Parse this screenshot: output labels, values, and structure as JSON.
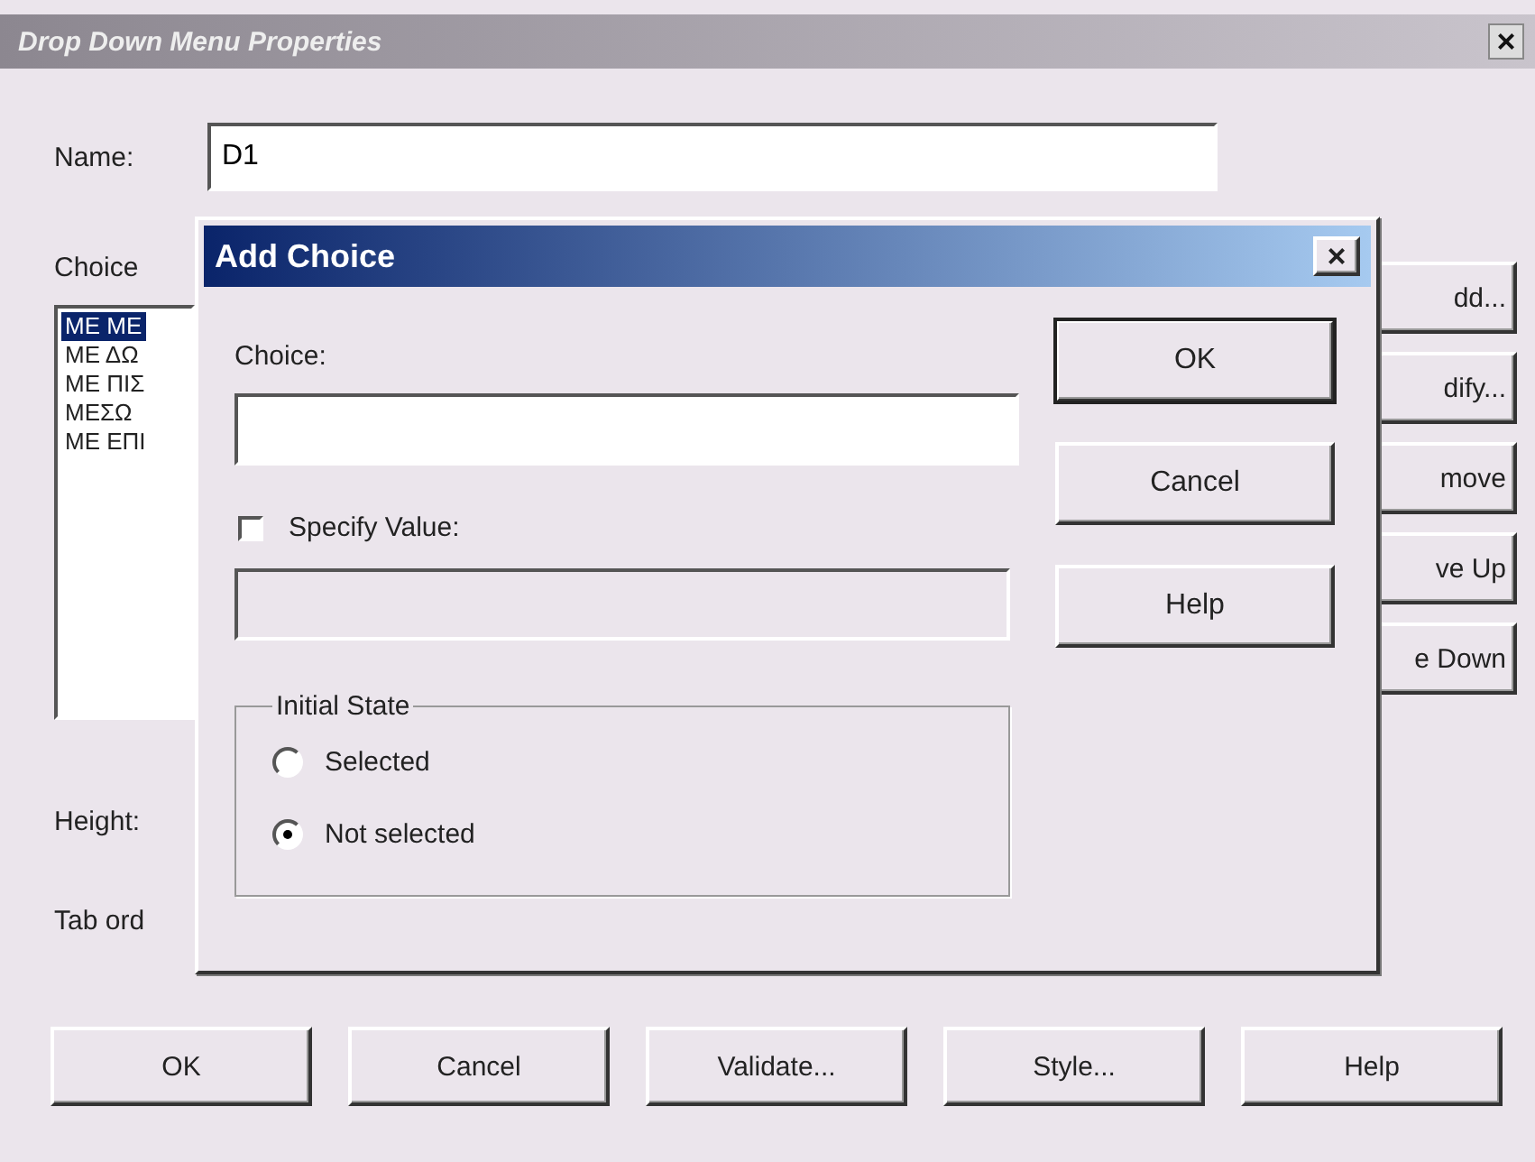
{
  "window": {
    "title": "Drop Down Menu Properties",
    "close": "×"
  },
  "name_field": {
    "label": "Name:",
    "value": "D1"
  },
  "choice_label": "Choice",
  "choices": [
    {
      "text": "ΜΕ ΜΕ",
      "selected": true
    },
    {
      "text": "ΜΕ ΔΩ",
      "selected": false
    },
    {
      "text": "ΜΕ ΠΙΣ",
      "selected": false
    },
    {
      "text": "ΜΕΣΩ",
      "selected": false
    },
    {
      "text": "ΜΕ ΕΠΙ",
      "selected": false
    }
  ],
  "side_buttons": [
    "dd...",
    "dify...",
    "move",
    "ve Up",
    "e Down"
  ],
  "height_label": "Height:",
  "tab_order_label": "Tab ord",
  "buttons": [
    "OK",
    "Cancel",
    "Validate...",
    "Style...",
    "Help"
  ],
  "add_choice": {
    "title": "Add Choice",
    "close": "×",
    "choice_label": "Choice:",
    "specify_value": {
      "label": "Specify Value:",
      "checked": false
    },
    "value_field": {
      "disabled": true
    },
    "initial_state": {
      "label": "Initial State",
      "options": [
        {
          "label": "Selected",
          "selected": false
        },
        {
          "label": "Not selected",
          "selected": true
        }
      ]
    },
    "buttons": [
      {
        "label": "OK",
        "default": true
      },
      {
        "label": "Cancel",
        "default": false
      },
      {
        "label": "Help",
        "default": false
      }
    ]
  }
}
